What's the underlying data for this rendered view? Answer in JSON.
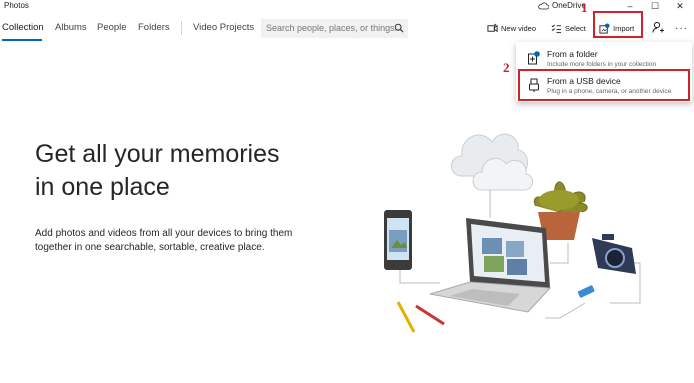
{
  "window": {
    "title": "Photos",
    "onedrive_label": "OneDrive",
    "controls": [
      "–",
      "☐",
      "✕"
    ]
  },
  "nav": {
    "tabs": [
      "Collection",
      "Albums",
      "People",
      "Folders",
      "Video Projects"
    ],
    "active_tab": "Collection",
    "search_placeholder": "Search people, places, or things..."
  },
  "toolbar": {
    "new_video": "New video",
    "select": "Select",
    "import": "Import",
    "more": "···"
  },
  "annotations": {
    "step1": "1",
    "step2": "2"
  },
  "import_menu": {
    "items": [
      {
        "title": "From a folder",
        "subtitle": "Include more folders in your collection",
        "icon": "folder-add-icon"
      },
      {
        "title": "From a USB device",
        "subtitle": "Plug in a phone, camera, or another device",
        "icon": "usb-device-icon"
      }
    ]
  },
  "hero": {
    "title_line1": "Get all your memories",
    "title_line2": "in one place",
    "description": "Add photos and videos from all your devices to bring them together in one searchable, sortable, creative place."
  },
  "colors": {
    "accent": "#0067b8",
    "highlight": "#d0222a"
  }
}
